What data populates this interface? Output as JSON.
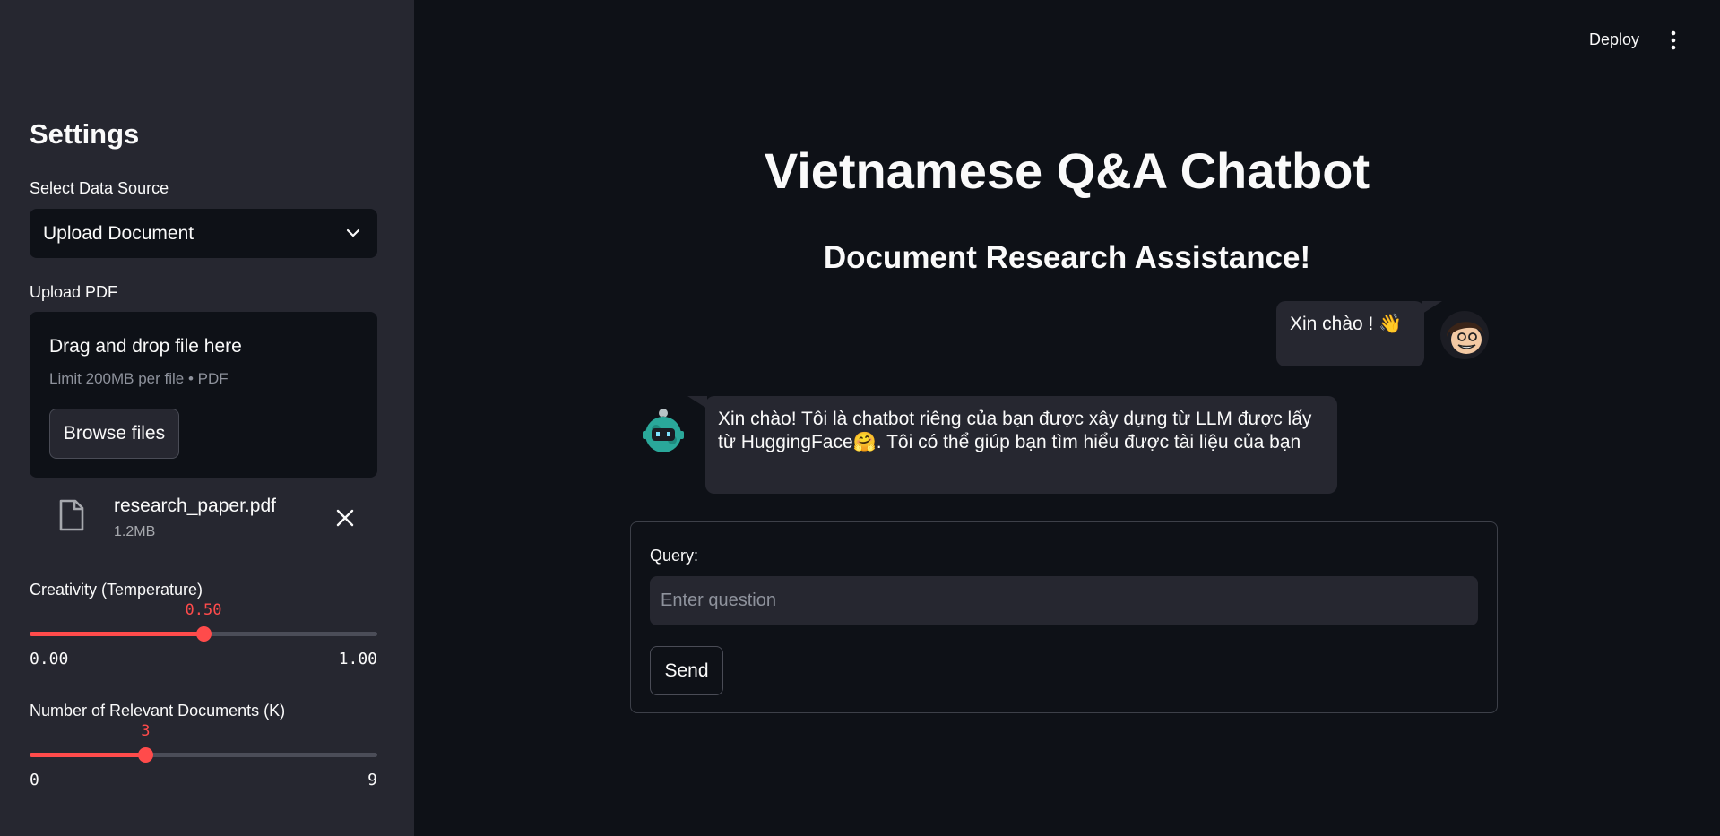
{
  "header": {
    "deploy_label": "Deploy",
    "menu_icon": "kebab-menu-icon"
  },
  "sidebar": {
    "title": "Settings",
    "data_source": {
      "label": "Select Data Source",
      "selected": "Upload Document"
    },
    "upload": {
      "label": "Upload PDF",
      "dropzone_title": "Drag and drop file here",
      "dropzone_limit": "Limit 200MB per file • PDF",
      "browse_label": "Browse files",
      "file": {
        "name": "research_paper.pdf",
        "size": "1.2MB"
      }
    },
    "temperature": {
      "label": "Creativity (Temperature)",
      "value": "0.50",
      "value_fraction": 0.5,
      "min": "0.00",
      "max": "1.00"
    },
    "k_docs": {
      "label": "Number of Relevant Documents (K)",
      "value": "3",
      "value_fraction": 0.3333,
      "min": "0",
      "max": "9"
    }
  },
  "main": {
    "title": "Vietnamese Q&A Chatbot",
    "subtitle": "Document Research Assistance!",
    "messages": [
      {
        "role": "user",
        "text": "Xin chào ! 👋"
      },
      {
        "role": "assistant",
        "text": "Xin chào! Tôi là chatbot riêng của bạn được xây dựng từ LLM được lấy từ HuggingFace🤗. Tôi có thể giúp bạn tìm hiểu được tài liệu của bạn"
      }
    ],
    "query": {
      "label": "Query:",
      "placeholder": "Enter question",
      "value": "",
      "send_label": "Send"
    }
  },
  "colors": {
    "accent": "#ff4b4b",
    "background": "#0e1117",
    "sidebar": "#262730"
  }
}
